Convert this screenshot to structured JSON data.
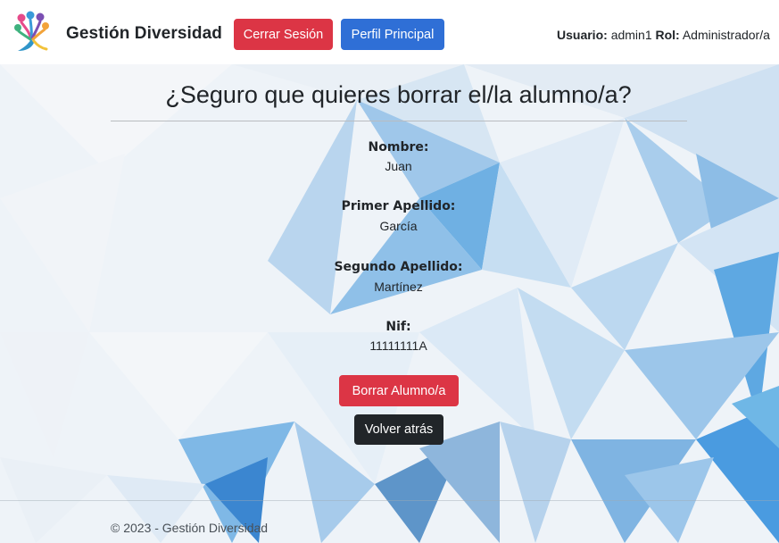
{
  "navbar": {
    "brand": "Gestión Diversidad",
    "logout_label": "Cerrar Sesión",
    "profile_label": "Perfil Principal",
    "user_key": "Usuario:",
    "user_value": "admin1",
    "role_key": "Rol:",
    "role_value": "Administrador/a"
  },
  "main": {
    "title": "¿Seguro que quieres borrar el/la alumno/a?",
    "fields": [
      {
        "label": "Nombre:",
        "value": "Juan"
      },
      {
        "label": "Primer Apellido:",
        "value": "García"
      },
      {
        "label": "Segundo Apellido:",
        "value": "Martínez"
      },
      {
        "label": "Nif:",
        "value": "11111111A"
      }
    ],
    "delete_label": "Borrar Alumno/a",
    "back_label": "Volver atrás"
  },
  "footer": {
    "text": "© 2023 - Gestión Diversidad"
  },
  "colors": {
    "danger": "#dc3545",
    "primary": "#2f6fd6",
    "dark": "#212529"
  }
}
